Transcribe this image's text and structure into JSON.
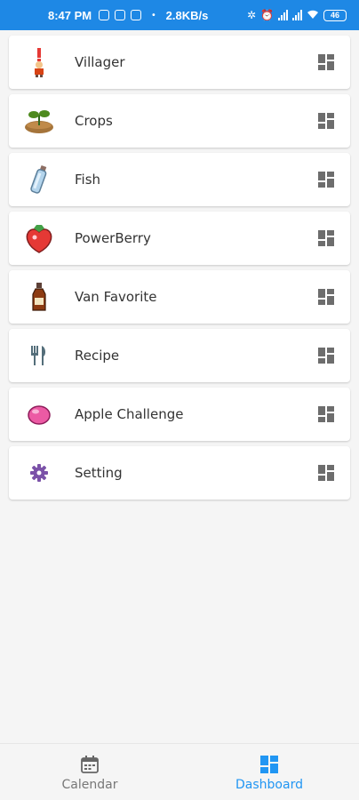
{
  "status_bar": {
    "time": "8:47 PM",
    "net_speed": "2.8KB/s",
    "battery": "46"
  },
  "colors": {
    "status_bar_bg": "#1e88e5",
    "accent": "#2196f3",
    "item_action_icon": "#6d6d6d"
  },
  "menu": {
    "items": [
      {
        "label": "Villager",
        "icon": "villager-icon"
      },
      {
        "label": "Crops",
        "icon": "sprout-icon"
      },
      {
        "label": "Fish",
        "icon": "bottle-icon"
      },
      {
        "label": "PowerBerry",
        "icon": "berry-icon"
      },
      {
        "label": "Van Favorite",
        "icon": "syrup-bottle-icon"
      },
      {
        "label": "Recipe",
        "icon": "fork-knife-icon"
      },
      {
        "label": "Apple Challenge",
        "icon": "apple-icon"
      },
      {
        "label": "Setting",
        "icon": "gear-icon"
      }
    ],
    "action_icon": "dashboard-icon"
  },
  "bottom_nav": {
    "tabs": [
      {
        "label": "Calendar",
        "icon": "calendar-icon",
        "active": false
      },
      {
        "label": "Dashboard",
        "icon": "dashboard-icon",
        "active": true
      }
    ]
  }
}
